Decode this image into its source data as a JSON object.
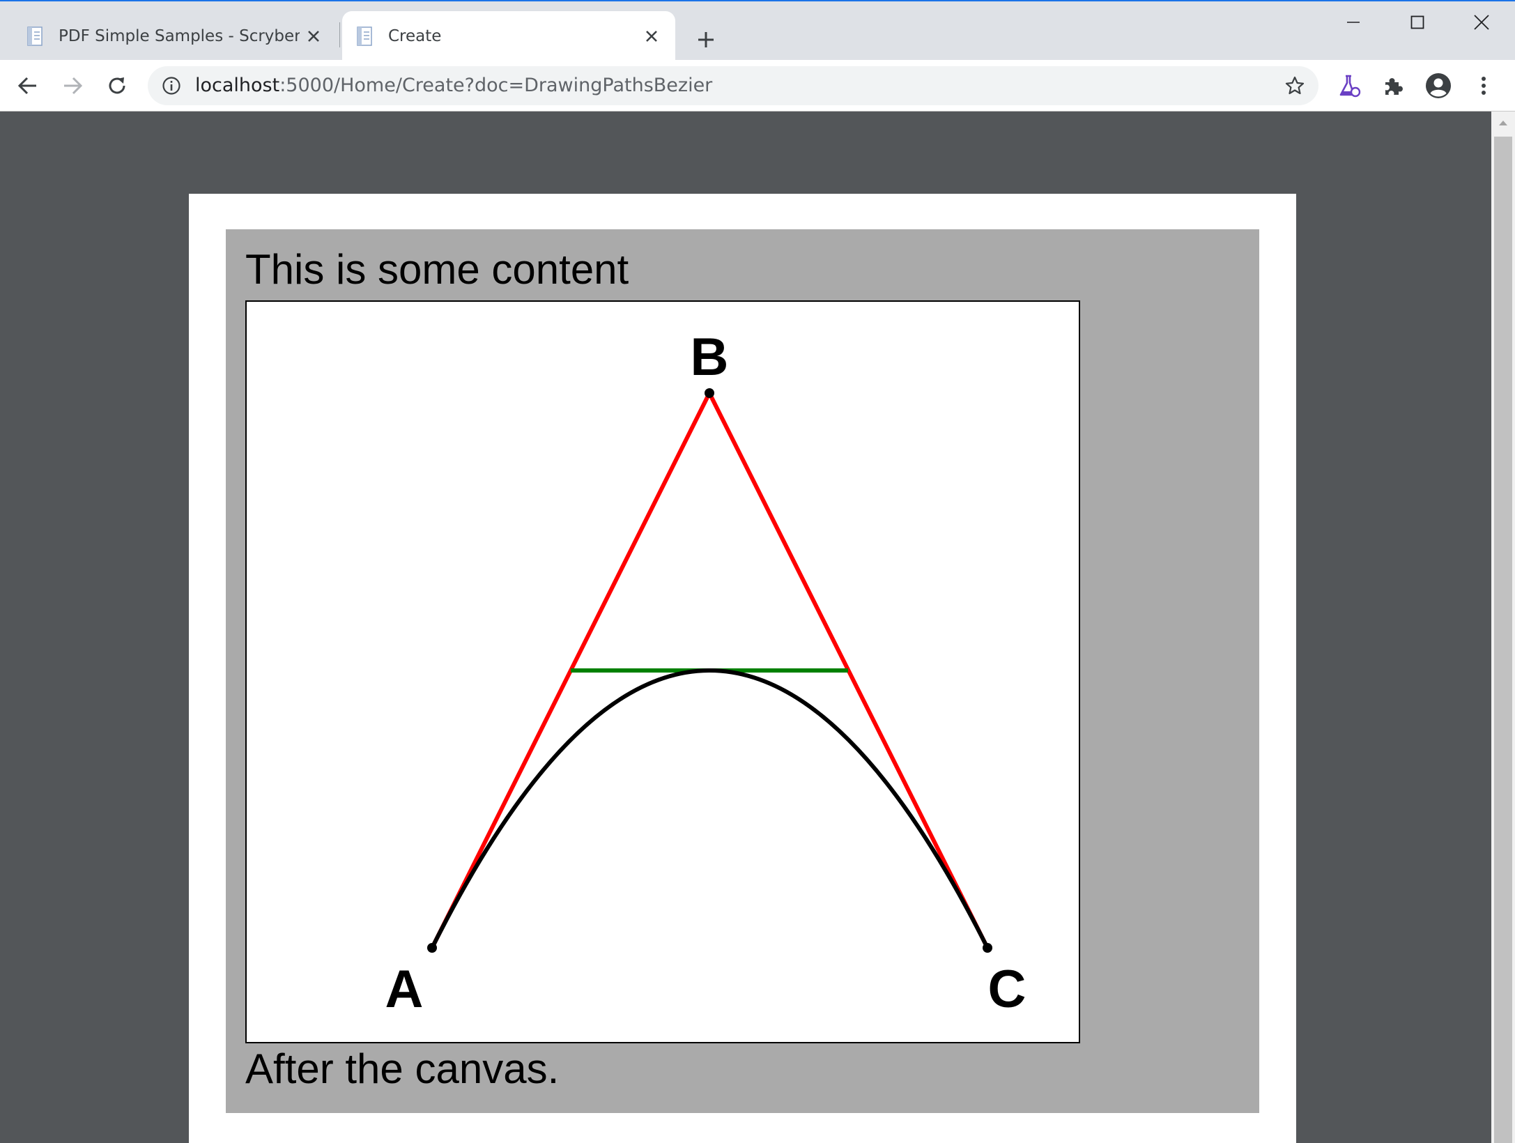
{
  "browser": {
    "tabs": [
      {
        "title": "PDF Simple Samples - Scryber",
        "active": false
      },
      {
        "title": "Create",
        "active": true
      }
    ],
    "address_bar": {
      "host": "localhost",
      "path": ":5000/Home/Create?doc=DrawingPathsBezier"
    },
    "accent_color": "#1a73e8"
  },
  "document": {
    "heading": "This is some content",
    "footer_text": "After the canvas.",
    "canvas": {
      "labels": {
        "a": "A",
        "b": "B",
        "c": "C"
      },
      "colors": {
        "control_lines": "#ff0000",
        "midline": "#008000",
        "curve": "#000000",
        "points": "#000000"
      }
    }
  }
}
